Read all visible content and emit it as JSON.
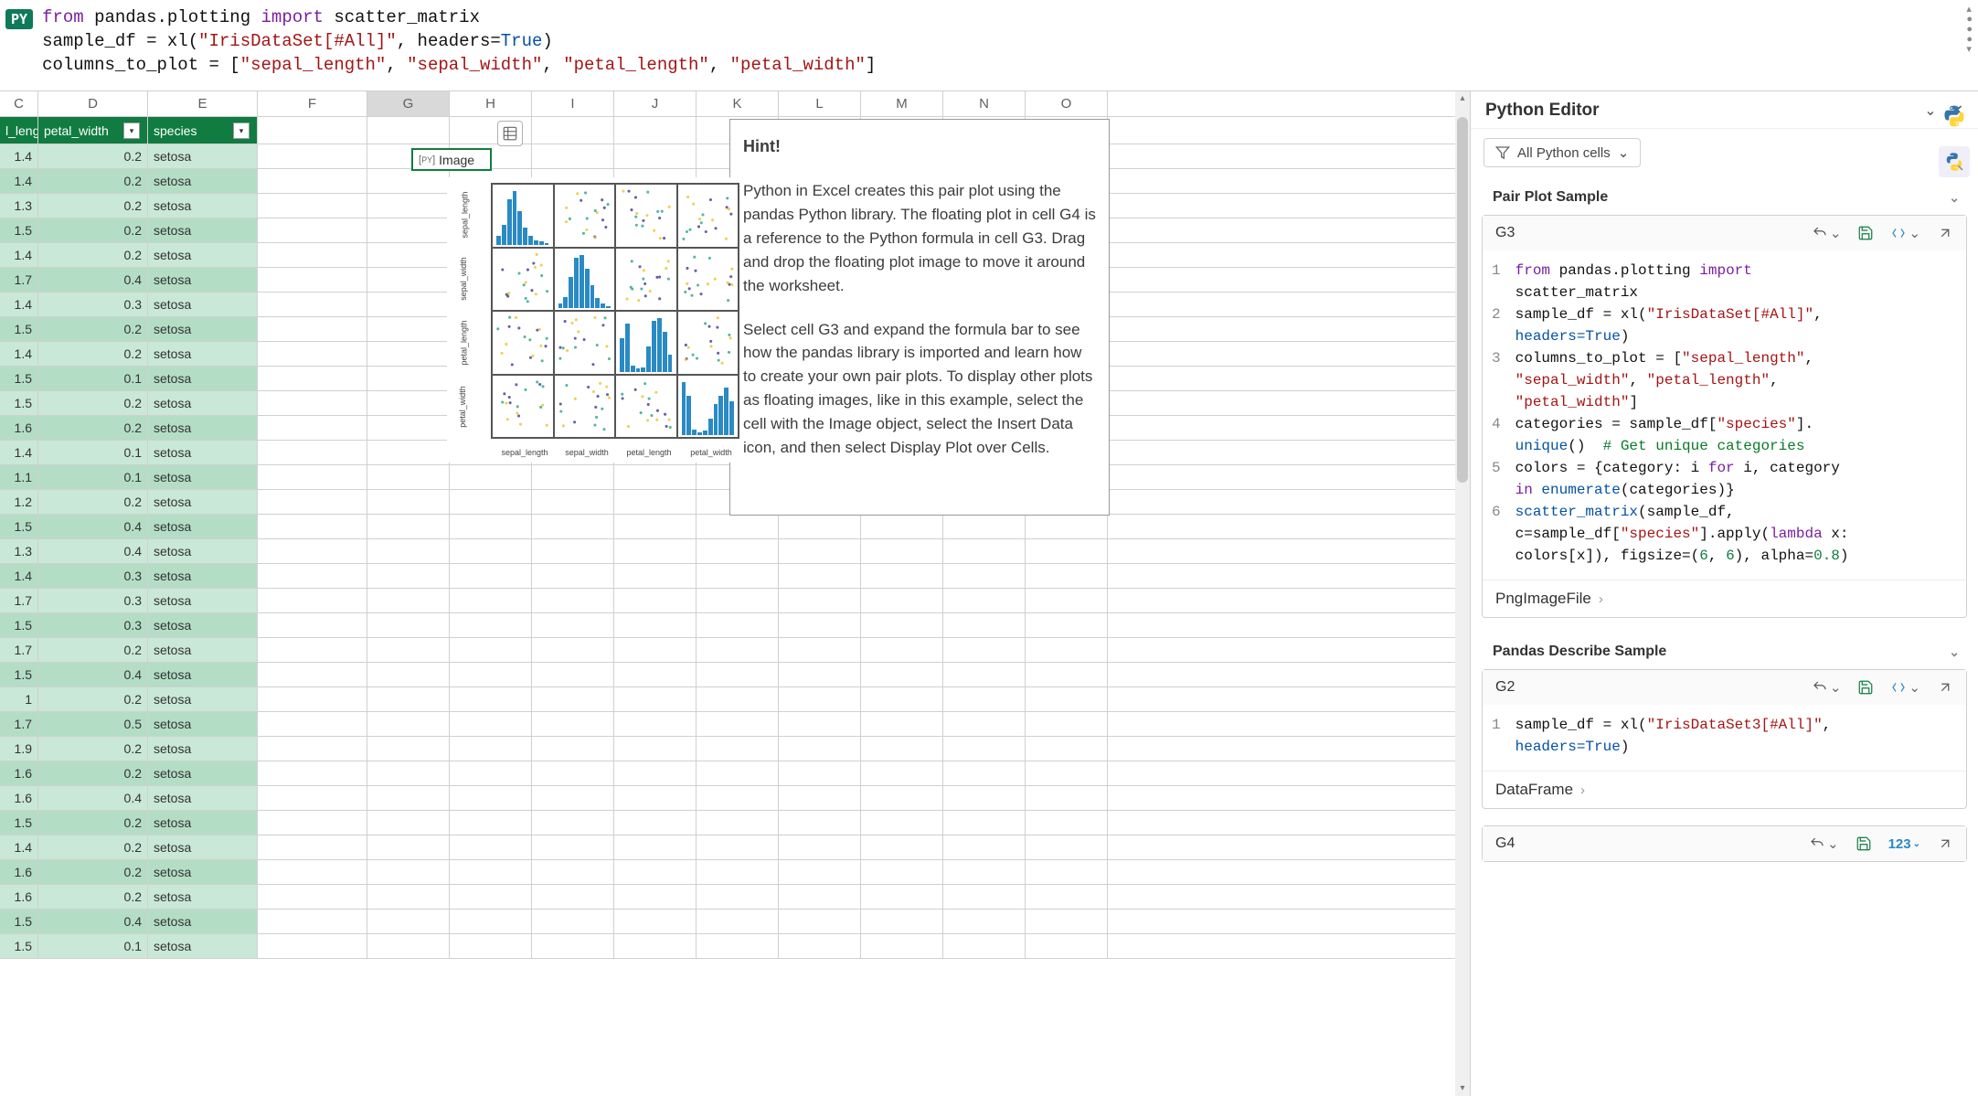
{
  "formula_bar": {
    "badge": "PY",
    "code_line1_kw1": "from",
    "code_line1_mod": "pandas.plotting",
    "code_line1_kw2": "import",
    "code_line1_name": "scatter_matrix",
    "code_line2_prefix": "sample_df = xl(",
    "code_line2_str": "\"IrisDataSet[#All]\"",
    "code_line2_mid": ", headers=",
    "code_line2_bool": "True",
    "code_line2_suffix": ")",
    "code_line3_prefix": "columns_to_plot = [",
    "code_line3_s1": "\"sepal_length\"",
    "code_line3_s2": "\"sepal_width\"",
    "code_line3_s3": "\"petal_length\"",
    "code_line3_s4": "\"petal_width\"",
    "code_line3_suffix": "]"
  },
  "columns": [
    "C",
    "D",
    "E",
    "F",
    "G",
    "H",
    "I",
    "J",
    "K",
    "L",
    "M",
    "N",
    "O"
  ],
  "table_headers": {
    "c": "l_lengtl",
    "d": "petal_width",
    "e": "species"
  },
  "table_rows": [
    {
      "c": "1.4",
      "d": "0.2",
      "e": "setosa"
    },
    {
      "c": "1.4",
      "d": "0.2",
      "e": "setosa"
    },
    {
      "c": "1.3",
      "d": "0.2",
      "e": "setosa"
    },
    {
      "c": "1.5",
      "d": "0.2",
      "e": "setosa"
    },
    {
      "c": "1.4",
      "d": "0.2",
      "e": "setosa"
    },
    {
      "c": "1.7",
      "d": "0.4",
      "e": "setosa"
    },
    {
      "c": "1.4",
      "d": "0.3",
      "e": "setosa"
    },
    {
      "c": "1.5",
      "d": "0.2",
      "e": "setosa"
    },
    {
      "c": "1.4",
      "d": "0.2",
      "e": "setosa"
    },
    {
      "c": "1.5",
      "d": "0.1",
      "e": "setosa"
    },
    {
      "c": "1.5",
      "d": "0.2",
      "e": "setosa"
    },
    {
      "c": "1.6",
      "d": "0.2",
      "e": "setosa"
    },
    {
      "c": "1.4",
      "d": "0.1",
      "e": "setosa"
    },
    {
      "c": "1.1",
      "d": "0.1",
      "e": "setosa"
    },
    {
      "c": "1.2",
      "d": "0.2",
      "e": "setosa"
    },
    {
      "c": "1.5",
      "d": "0.4",
      "e": "setosa"
    },
    {
      "c": "1.3",
      "d": "0.4",
      "e": "setosa"
    },
    {
      "c": "1.4",
      "d": "0.3",
      "e": "setosa"
    },
    {
      "c": "1.7",
      "d": "0.3",
      "e": "setosa"
    },
    {
      "c": "1.5",
      "d": "0.3",
      "e": "setosa"
    },
    {
      "c": "1.7",
      "d": "0.2",
      "e": "setosa"
    },
    {
      "c": "1.5",
      "d": "0.4",
      "e": "setosa"
    },
    {
      "c": "1",
      "d": "0.2",
      "e": "setosa"
    },
    {
      "c": "1.7",
      "d": "0.5",
      "e": "setosa"
    },
    {
      "c": "1.9",
      "d": "0.2",
      "e": "setosa"
    },
    {
      "c": "1.6",
      "d": "0.2",
      "e": "setosa"
    },
    {
      "c": "1.6",
      "d": "0.4",
      "e": "setosa"
    },
    {
      "c": "1.5",
      "d": "0.2",
      "e": "setosa"
    },
    {
      "c": "1.4",
      "d": "0.2",
      "e": "setosa"
    },
    {
      "c": "1.6",
      "d": "0.2",
      "e": "setosa"
    },
    {
      "c": "1.6",
      "d": "0.2",
      "e": "setosa"
    },
    {
      "c": "1.5",
      "d": "0.4",
      "e": "setosa"
    },
    {
      "c": "1.5",
      "d": "0.1",
      "e": "setosa"
    }
  ],
  "active_cell": {
    "badge": "[PY]",
    "label": "Image"
  },
  "plot": {
    "labels": [
      "sepal_length",
      "sepal_width",
      "petal_length",
      "petal_width"
    ]
  },
  "hint": {
    "title": "Hint!",
    "p1": "Python in Excel creates this pair plot using the pandas Python library. The floating plot in cell G4 is a reference to the Python formula in cell G3. Drag and drop the floating plot image to move it around the worksheet.",
    "p2": "Select cell G3 and expand the formula bar to see how the pandas library is imported and learn how to create your own pair plots. To display other plots as floating images, like in this example, select the cell with the Image object, select the Insert Data icon, and then select Display Plot over Cells."
  },
  "editor": {
    "title": "Python Editor",
    "filter_label": "All Python cells",
    "section1_title": "Pair Plot Sample",
    "section2_title": "Pandas Describe Sample",
    "card1": {
      "ref": "G3",
      "type_badge": "[ ]",
      "output": "PngImageFile",
      "code": {
        "l1a": "from",
        "l1b": "pandas.plotting",
        "l1c": "import",
        "l1d": "scatter_matrix",
        "l2a": "sample_df = xl(",
        "l2b": "\"IrisDataSet[#All]\"",
        "l2c": ", ",
        "l2d": "headers=",
        "l2e": "True",
        "l2f": ")",
        "l3a": "columns_to_plot = [",
        "l3b": "\"sepal_length\"",
        "l3c": ", ",
        "l3d": "\"sepal_width\"",
        "l3e": ", ",
        "l3f": "\"petal_length\"",
        "l3g": ", ",
        "l3h": "\"petal_width\"",
        "l3i": "]",
        "l4a": "categories = sample_df[",
        "l4b": "\"species\"",
        "l4c": "].",
        "l4d": "unique",
        "l4e": "()  ",
        "l4f": "# Get unique categories",
        "l5a": "colors = {category: i ",
        "l5b": "for",
        "l5c": " i, category ",
        "l5d": "in",
        "l5e": " ",
        "l5f": "enumerate",
        "l5g": "(categories)}",
        "l6a": "scatter_matrix",
        "l6b": "(sample_df, c=sample_df[",
        "l6c": "\"species\"",
        "l6d": "].apply(",
        "l6e": "lambda",
        "l6f": " x: colors[x]), figsize=(",
        "l6g": "6",
        "l6h": ", ",
        "l6i": "6",
        "l6j": "), alpha=",
        "l6k": "0.8",
        "l6l": ")"
      }
    },
    "card2": {
      "ref": "G2",
      "type_badge": "[ ]",
      "output": "DataFrame",
      "code": {
        "l1a": "sample_df = xl(",
        "l1b": "\"IrisDataSet3[#All]\"",
        "l1c": ", ",
        "l1d": "headers=",
        "l1e": "True",
        "l1f": ")"
      }
    },
    "card3": {
      "ref": "G4",
      "type_badge": "123"
    }
  }
}
